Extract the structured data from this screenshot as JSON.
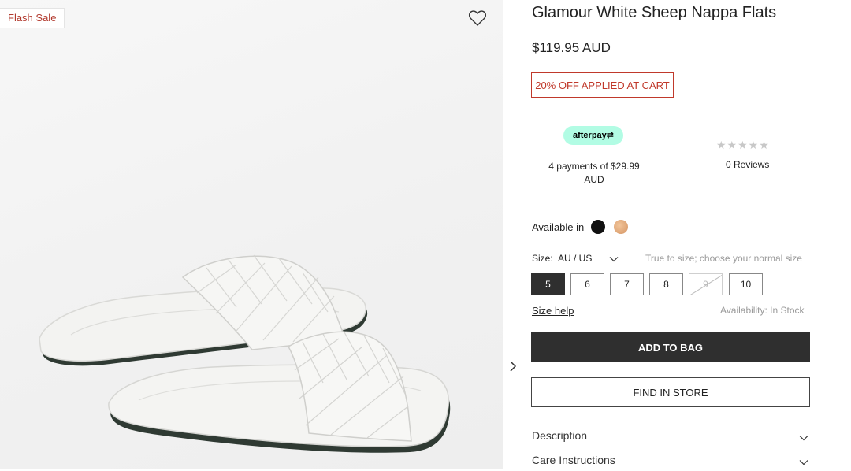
{
  "gallery": {
    "badge": "Flash Sale",
    "wishlist_icon": "heart-outline-icon",
    "next_icon": "chevron-right-icon"
  },
  "product": {
    "title": "Glamour White Sheep Nappa Flats",
    "price": "$119.95 AUD",
    "promo": "20% OFF APPLIED AT CART"
  },
  "afterpay": {
    "logo_text": "afterpay",
    "installment_text": "4 payments of $29.99 AUD"
  },
  "rating": {
    "stars": "★★★★★",
    "stars_filled": 0,
    "reviews_link": "0 Reviews"
  },
  "colors": {
    "label": "Available in",
    "options": [
      {
        "name": "black",
        "hex": "#111111"
      },
      {
        "name": "tan",
        "hex": "#e0a875"
      }
    ]
  },
  "size": {
    "label": "Size:",
    "system": "AU / US",
    "note": "True to size; choose your normal size",
    "options": [
      {
        "label": "5",
        "state": "selected"
      },
      {
        "label": "6",
        "state": "available"
      },
      {
        "label": "7",
        "state": "available"
      },
      {
        "label": "8",
        "state": "available"
      },
      {
        "label": "9",
        "state": "out-of-stock"
      },
      {
        "label": "10",
        "state": "available"
      }
    ],
    "help_link": "Size help",
    "availability": "Availability: In Stock"
  },
  "actions": {
    "add_to_bag": "ADD TO BAG",
    "find_in_store": "FIND IN STORE"
  },
  "accordions": [
    {
      "label": "Description"
    },
    {
      "label": "Care Instructions"
    }
  ],
  "theme": {
    "accent_red": "#c0392b",
    "primary_button": "#2f2f2f",
    "afterpay_mint": "#b2fce4"
  }
}
